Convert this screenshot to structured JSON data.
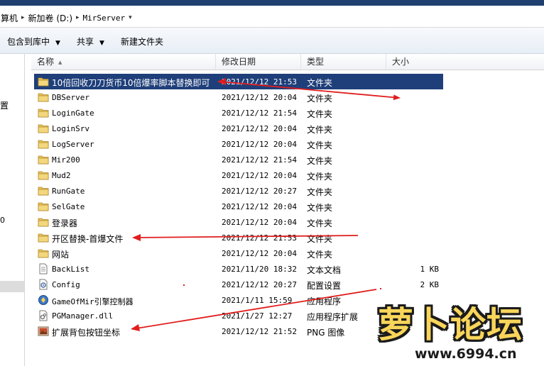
{
  "address": {
    "crumbs": [
      "算机",
      "新加卷 (D:)",
      "MirServer"
    ],
    "separator": "▸",
    "dropdown": "▾"
  },
  "toolbar": {
    "include_label": "包含到库中",
    "share_label": "共享",
    "new_folder_label": "新建文件夹",
    "dropdown": "▼"
  },
  "navpane": {
    "fragment_1": "置",
    "fragment_2": "0"
  },
  "columns": {
    "name": "名称",
    "date": "修改日期",
    "type": "类型",
    "size": "大小",
    "sort_icon": "▲"
  },
  "files": [
    {
      "name": "10倍回收刀刀货币10倍爆率脚本替换即可",
      "date": "2021/12/12 21:53",
      "type": "文件夹",
      "size": "",
      "icon": "folder-icon",
      "selected": true
    },
    {
      "name": "DBServer",
      "date": "2021/12/12 20:04",
      "type": "文件夹",
      "size": "",
      "icon": "folder-icon"
    },
    {
      "name": "LoginGate",
      "date": "2021/12/12 21:54",
      "type": "文件夹",
      "size": "",
      "icon": "folder-icon"
    },
    {
      "name": "LoginSrv",
      "date": "2021/12/12 20:04",
      "type": "文件夹",
      "size": "",
      "icon": "folder-icon"
    },
    {
      "name": "LogServer",
      "date": "2021/12/12 20:04",
      "type": "文件夹",
      "size": "",
      "icon": "folder-icon"
    },
    {
      "name": "Mir200",
      "date": "2021/12/12 21:54",
      "type": "文件夹",
      "size": "",
      "icon": "folder-icon"
    },
    {
      "name": "Mud2",
      "date": "2021/12/12 20:04",
      "type": "文件夹",
      "size": "",
      "icon": "folder-icon"
    },
    {
      "name": "RunGate",
      "date": "2021/12/12 20:27",
      "type": "文件夹",
      "size": "",
      "icon": "folder-icon"
    },
    {
      "name": "SelGate",
      "date": "2021/12/12 20:04",
      "type": "文件夹",
      "size": "",
      "icon": "folder-icon"
    },
    {
      "name": "登录器",
      "date": "2021/12/12 20:04",
      "type": "文件夹",
      "size": "",
      "icon": "folder-icon"
    },
    {
      "name": "开区替换-首爆文件",
      "date": "2021/12/12 21:53",
      "type": "文件夹",
      "size": "",
      "icon": "folder-icon"
    },
    {
      "name": "网站",
      "date": "2021/12/12 20:04",
      "type": "文件夹",
      "size": "",
      "icon": "folder-icon"
    },
    {
      "name": "BackList",
      "date": "2021/11/20 18:32",
      "type": "文本文档",
      "size": "1 KB",
      "icon": "text-file-icon"
    },
    {
      "name": "Config",
      "date": "2021/12/12 20:27",
      "type": "配置设置",
      "size": "2 KB",
      "icon": "config-file-icon"
    },
    {
      "name": "GameOfMir引擎控制器",
      "date": "2021/1/11 15:59",
      "type": "应用程序",
      "size": "",
      "icon": "app-icon"
    },
    {
      "name": "PGManager.dll",
      "date": "2021/1/27 12:27",
      "type": "应用程序扩展",
      "size": "",
      "icon": "dll-file-icon"
    },
    {
      "name": "扩展背包按钮坐标",
      "date": "2021/12/12 21:52",
      "type": "PNG 图像",
      "size": "",
      "icon": "image-file-icon"
    }
  ],
  "watermark": {
    "title": "萝卜论坛",
    "url": "www.6994.cn"
  },
  "colors": {
    "selection": "#1f3f7a",
    "arrow": "#e01e1e",
    "folder": "#e8c25a"
  }
}
